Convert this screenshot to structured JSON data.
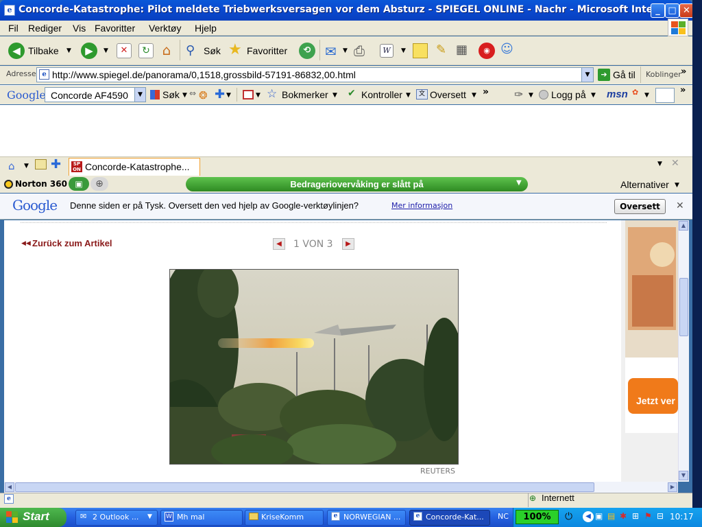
{
  "window": {
    "title": "Concorde-Katastrophe: Pilot meldete Triebwerksversagen vor dem Absturz - SPIEGEL ONLINE - Nachr - Microsoft Internet Expl..."
  },
  "menu": [
    "Fil",
    "Rediger",
    "Vis",
    "Favoritter",
    "Verktøy",
    "Hjelp"
  ],
  "toolbar": {
    "back": "Tilbake",
    "search": "Søk",
    "favorites": "Favoritter"
  },
  "address": {
    "label": "Adresse",
    "url": "http://www.spiegel.de/panorama/0,1518,grossbild-57191-86832,00.html",
    "go": "Gå til",
    "links": "Koblinger"
  },
  "google_toolbar": {
    "logo": "Google",
    "query": "Concorde AF4590",
    "search": "Søk",
    "bookmarks": "Bokmerker",
    "check": "Kontroller",
    "translate": "Oversett",
    "login": "Logg på",
    "msn": "msn"
  },
  "tab": {
    "title": "Concorde-Katastrophe..."
  },
  "norton": {
    "brand": "Norton 360",
    "phish": "Bedrageriovervåking er slått på",
    "options": "Alternativer"
  },
  "translate_bar": {
    "logo": "Google",
    "message": "Denne siden er på Tysk. Oversett den ved hjelp av Google-verktøylinjen?",
    "link": "Mer informasjon",
    "button": "Oversett"
  },
  "page": {
    "back_link": "Zurück zum Artikel",
    "pager": "1 VON 3",
    "credit": "REUTERS"
  },
  "ad": {
    "cta": "Jetzt ver"
  },
  "status": {
    "zone": "Internett"
  },
  "taskbar": {
    "start": "Start",
    "tasks": [
      "2 Outlook ...",
      "Mh mal",
      "KriseKomm",
      "NORWEGIAN ...",
      "Concorde-Kat..."
    ],
    "lang": "NC",
    "zoom": "100%",
    "clock": "10:17"
  }
}
